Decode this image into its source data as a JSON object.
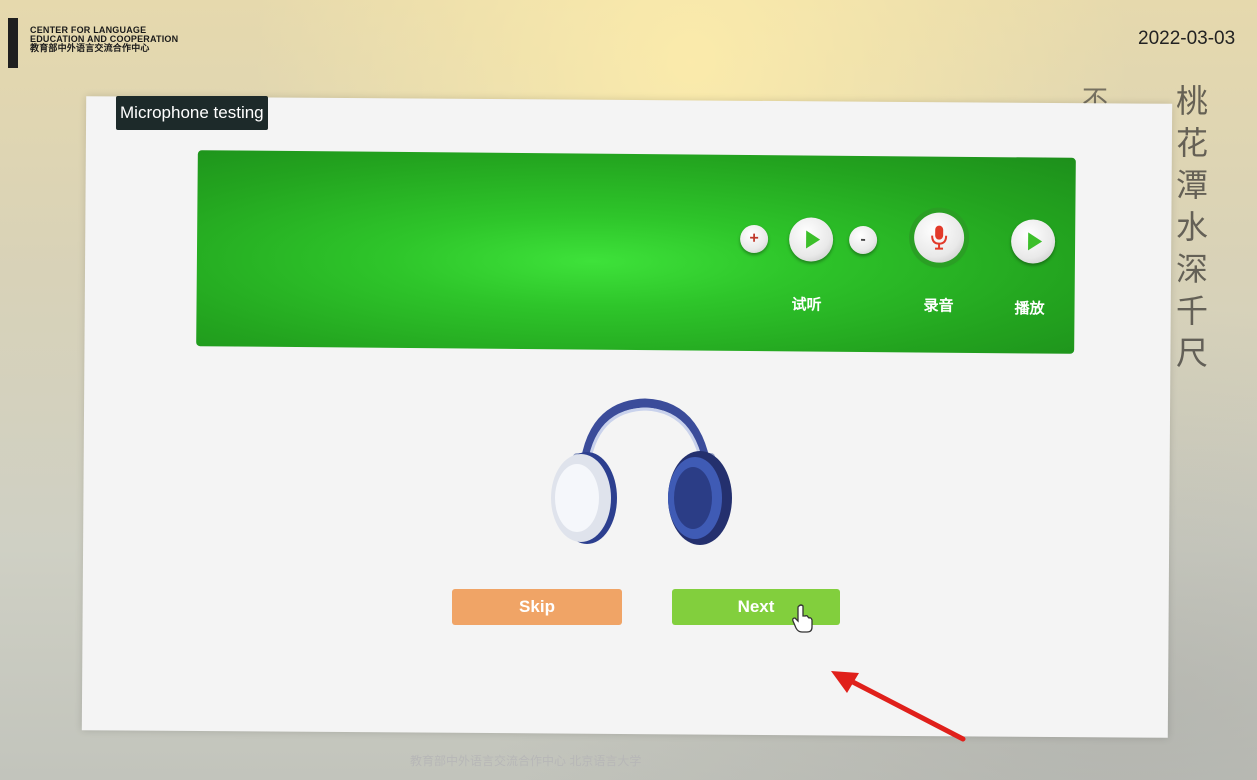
{
  "header": {
    "org_line1": "CENTER FOR LANGUAGE",
    "org_line2": "EDUCATION AND COOPERATION",
    "org_line3": "教育部中外语言交流合作中心",
    "date": "2022-03-03"
  },
  "background": {
    "poem_column": [
      "桃",
      "花",
      "潭",
      "水",
      "深",
      "千",
      "尺"
    ],
    "poem_extra": "不"
  },
  "dialog": {
    "title": "Microphone testing",
    "controls": {
      "volume_up_symbol": "+",
      "volume_down_symbol": "-",
      "listen_label": "试听",
      "record_label": "录音",
      "play_label": "播放"
    },
    "skip_label": "Skip",
    "next_label": "Next"
  },
  "footer": {
    "text": "教育部中外语言交流合作中心  北京语言大学"
  },
  "colors": {
    "green_panel": "#23a41f",
    "skip_button": "#f0a466",
    "next_button": "#82cf3d",
    "record_icon": "#e23a2a",
    "annotation_arrow": "#e0201b"
  },
  "icons": [
    "volume-up-icon",
    "play-icon",
    "volume-down-icon",
    "microphone-icon",
    "headphones-icon",
    "hand-cursor-icon",
    "red-arrow-annotation"
  ]
}
